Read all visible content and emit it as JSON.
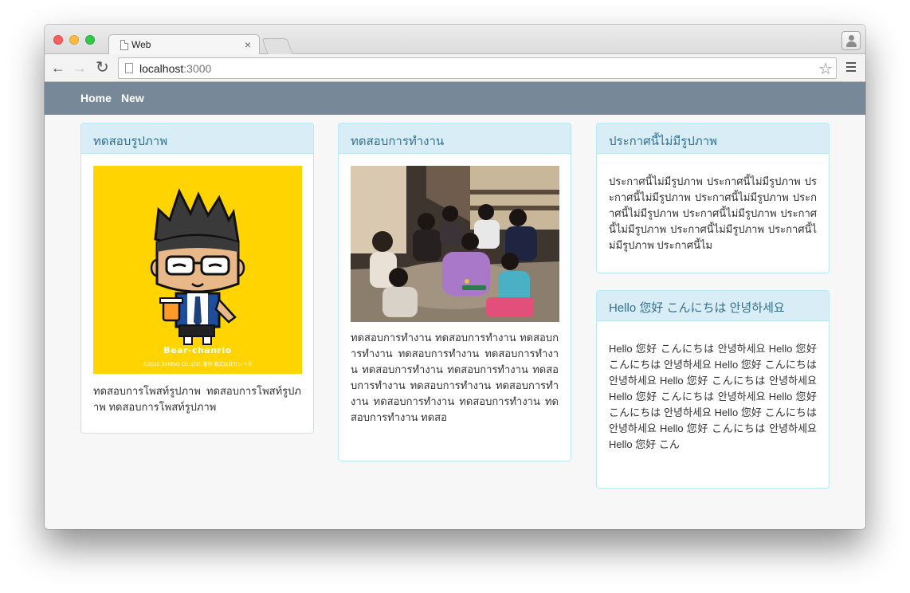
{
  "browser": {
    "tab_title": "Web",
    "tab_close": "×",
    "url_host": "localhost",
    "url_port": ":3000"
  },
  "icons": {
    "back": "←",
    "forward": "→",
    "reload": "↻",
    "star": "☆"
  },
  "navbar": {
    "color": "#778899",
    "links": [
      {
        "label": "Home"
      },
      {
        "label": "New"
      }
    ]
  },
  "panels": [
    {
      "title": "ทดสอบรูปภาพ",
      "image_caption": "Bear-chanrio",
      "image_fine_print": "©2015 SANRIO CO.,LTD. 著作 株式会社サンリオ",
      "body": "ทดสอบการโพสท์รูปภาพ ทดสอบการโพสท์รูปภาพ ทดสอบการโพสท์รูปภาพ"
    },
    {
      "title": "ทดสอบการทำงาน",
      "body": "ทดสอบการทำงาน ทดสอบการทำงาน ทดสอบการทำงาน ทดสอบการทำงาน ทดสอบการทำงาน ทดสอบการทำงาน ทดสอบการทำงาน ทดสอบการทำงาน ทดสอบการทำงาน ทดสอบการทำงาน ทดสอบการทำงาน ทดสอบการทำงาน ทดสอบการทำงาน ทดสอ"
    },
    {
      "title": "ประกาศนี้ไม่มีรูปภาพ",
      "body": "ประกาศนี้ไม่มีรูปภาพ ประกาศนี้ไม่มีรูปภาพ ประกาศนี้ไม่มีรูปภาพ ประกาศนี้ไม่มีรูปภาพ ประกาศนี้ไม่มีรูปภาพ ประกาศนี้ไม่มีรูปภาพ ประกาศนี้ไม่มีรูปภาพ ประกาศนี้ไม่มีรูปภาพ ประกาศนี้ไม่มีรูปภาพ ประกาศนี้ไม"
    },
    {
      "title": "Hello 您好 こんにちは 안녕하세요",
      "body": "Hello 您好 こんにちは 안녕하세요 Hello 您好 こんにちは 안녕하세요 Hello 您好 こんにちは 안녕하세요 Hello 您好 こんにちは 안녕하세요 Hello 您好 こんにちは 안녕하세요 Hello 您好 こんにちは 안녕하세요 Hello 您好 こんにちは 안녕하세요 Hello 您好 こんにちは 안녕하세요 Hello 您好 こん"
    }
  ]
}
